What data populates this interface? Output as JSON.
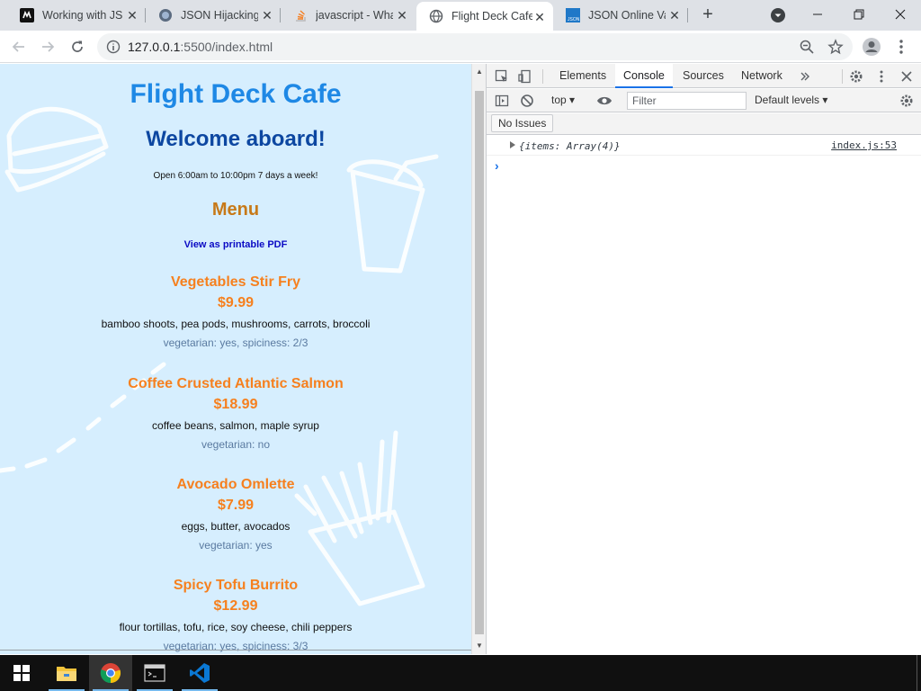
{
  "tabs": [
    {
      "title": "Working with JSON",
      "icon": "github-icon"
    },
    {
      "title": "JSON Hijacking",
      "icon": "globe-icon"
    },
    {
      "title": "javascript - What",
      "icon": "stackoverflow-icon"
    },
    {
      "title": "Flight Deck Cafe",
      "icon": "globe-icon",
      "active": true
    },
    {
      "title": "JSON Online Validator",
      "icon": "json-icon"
    }
  ],
  "address_bar": {
    "host": "127.0.0.1",
    "path": ":5500/index.html"
  },
  "page": {
    "title": "Flight Deck Cafe",
    "welcome": "Welcome aboard!",
    "hours": "Open 6:00am to 10:00pm 7 days a week!",
    "menu_heading": "Menu",
    "pdf_link": "View as printable PDF",
    "items": [
      {
        "name": "Vegetables Stir Fry",
        "price": "$9.99",
        "description": "bamboo shoots, pea pods, mushrooms, carrots, broccoli",
        "meta": "vegetarian: yes, spiciness: 2/3"
      },
      {
        "name": "Coffee Crusted Atlantic Salmon",
        "price": "$18.99",
        "description": "coffee beans, salmon, maple syrup",
        "meta": "vegetarian: no"
      },
      {
        "name": "Avocado Omlette",
        "price": "$7.99",
        "description": "eggs, butter, avocados",
        "meta": "vegetarian: yes"
      },
      {
        "name": "Spicy Tofu Burrito",
        "price": "$12.99",
        "description": "flour tortillas, tofu, rice, soy cheese, chili peppers",
        "meta": "vegetarian: yes, spiciness: 3/3"
      }
    ]
  },
  "devtools": {
    "tabs": [
      "Elements",
      "Console",
      "Sources",
      "Network"
    ],
    "active_tab": "Console",
    "context": "top",
    "filter_placeholder": "Filter",
    "levels": "Default levels",
    "issues": "No Issues",
    "log_entry": "{items: Array(4)}",
    "log_source": "index.js:53"
  },
  "colors": {
    "page_bg": "#d6eefe",
    "title": "#1e88e5",
    "welcome": "#0d47a1",
    "menu_heading": "#c77918",
    "item_name": "#f6801e",
    "meta": "#5a7aa0"
  }
}
